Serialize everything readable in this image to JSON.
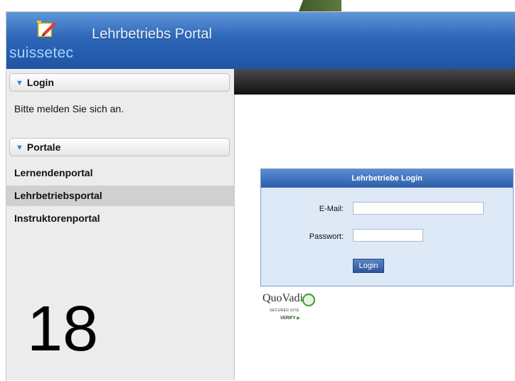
{
  "header": {
    "logo_text": "suissetec",
    "title": "Lehrbetriebs Portal"
  },
  "sidebar": {
    "login_section": {
      "label": "Login",
      "prompt": "Bitte melden Sie sich an."
    },
    "portals_section": {
      "label": "Portale",
      "items": [
        {
          "label": "Lernendenportal",
          "active": false
        },
        {
          "label": "Lehrbetriebsportal",
          "active": true
        },
        {
          "label": "Instruktorenportal",
          "active": false
        }
      ]
    }
  },
  "page_number": "18",
  "login_form": {
    "title": "Lehrbetriebe Login",
    "email_label": "E-Mail:",
    "email_value": "",
    "password_label": "Passwort:",
    "password_value": "",
    "submit_label": "Login"
  },
  "seal": {
    "name": "QuoVadis",
    "subtitle": "SECURED SITE",
    "verify": "VERIFY"
  },
  "colors": {
    "header_blue": "#2e66b8",
    "accent_triangle": "#2f7fe0",
    "login_panel": "#dde9f7",
    "seal_green": "#3b9b2b"
  }
}
